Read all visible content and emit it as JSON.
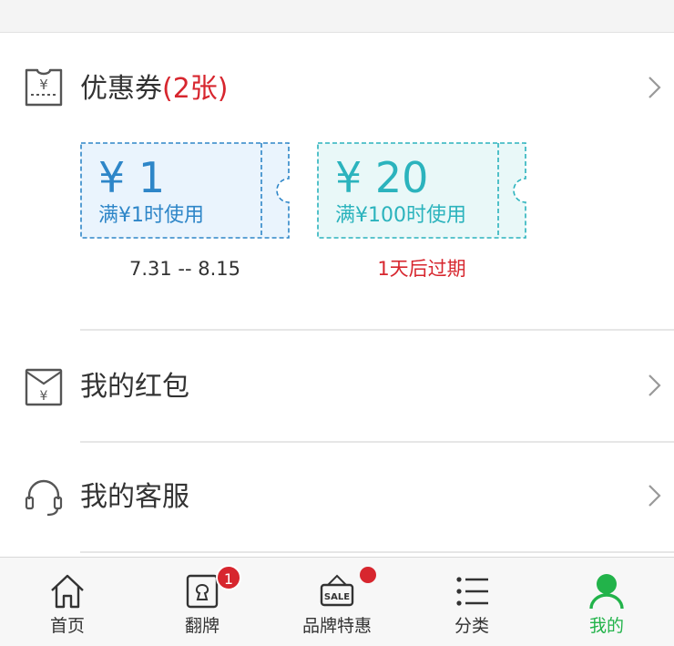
{
  "coupons_section": {
    "title": "优惠券",
    "count": "(2张)",
    "items": [
      {
        "amount": "¥ 1",
        "condition": "满¥1时使用",
        "note": "7.31 -- 8.15"
      },
      {
        "amount": "¥ 20",
        "condition": "满¥100时使用",
        "note": "1天后过期"
      }
    ]
  },
  "menu": {
    "red_packet": "我的红包",
    "customer_service": "我的客服"
  },
  "tabbar": {
    "items": [
      {
        "label": "首页",
        "icon": "home-icon"
      },
      {
        "label": "翻牌",
        "icon": "card-flip-icon",
        "badge": "1"
      },
      {
        "label": "品牌特惠",
        "icon": "sale-tag-icon",
        "dot": true
      },
      {
        "label": "分类",
        "icon": "list-icon"
      },
      {
        "label": "我的",
        "icon": "user-icon"
      }
    ]
  },
  "colors": {
    "accent_red": "#d7262e",
    "coupon_blue": "#2e86c8",
    "coupon_teal": "#2bb3bd",
    "active_green": "#22b34a"
  }
}
